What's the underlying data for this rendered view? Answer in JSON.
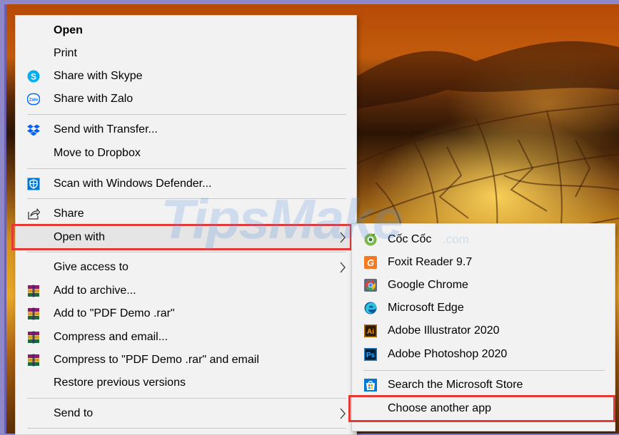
{
  "main_menu": {
    "items": [
      {
        "label": "Open"
      },
      {
        "label": "Print"
      },
      {
        "label": "Share with Skype"
      },
      {
        "label": "Share with Zalo"
      },
      {
        "label": "Send with Transfer..."
      },
      {
        "label": "Move to Dropbox"
      },
      {
        "label": "Scan with Windows Defender..."
      },
      {
        "label": "Share"
      },
      {
        "label": "Open with"
      },
      {
        "label": "Give access to"
      },
      {
        "label": "Add to archive..."
      },
      {
        "label": "Add to \"PDF Demo .rar\""
      },
      {
        "label": "Compress and email..."
      },
      {
        "label": "Compress to \"PDF Demo .rar\" and email"
      },
      {
        "label": "Restore previous versions"
      },
      {
        "label": "Send to"
      }
    ]
  },
  "open_with_submenu": {
    "items": [
      {
        "label": "Cốc Cốc"
      },
      {
        "label": "Foxit Reader 9.7"
      },
      {
        "label": "Google Chrome"
      },
      {
        "label": "Microsoft Edge"
      },
      {
        "label": "Adobe Illustrator 2020"
      },
      {
        "label": "Adobe Photoshop 2020"
      },
      {
        "label": "Search the Microsoft Store"
      },
      {
        "label": "Choose another app"
      }
    ]
  },
  "icons": {
    "skype": "S",
    "zalo": "Zalo",
    "foxit": "G",
    "illustrator": "Ai",
    "photoshop": "Ps"
  },
  "watermark": {
    "brand": "TipsMake",
    "suffix": ".com"
  },
  "colors": {
    "menu_bg": "#f2f2f2",
    "highlight_border": "#e53935",
    "skype": "#00aff0",
    "dropbox": "#0061fe",
    "defender": "#0078d4"
  }
}
